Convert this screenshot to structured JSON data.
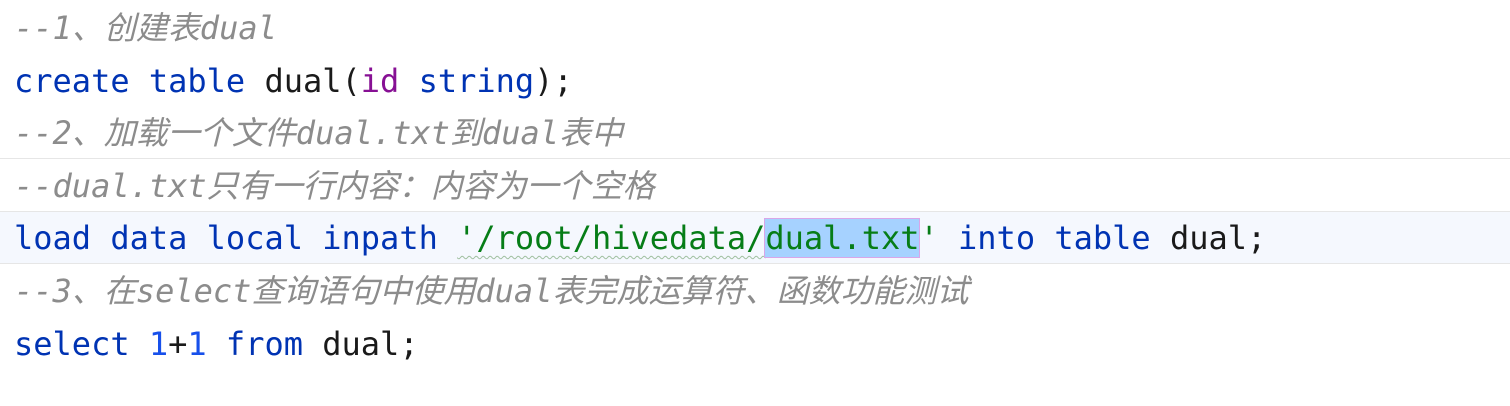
{
  "editor": {
    "lines": [
      {
        "comment": "--1、创建表dual"
      },
      {
        "kw_create": "create",
        "kw_table": "table",
        "ident": "dual",
        "open_paren": "(",
        "field": "id",
        "type": "string",
        "close": ");"
      },
      {
        "comment": "--2、加载一个文件dual.txt到dual表中"
      },
      {
        "comment": "--dual.txt只有一行内容：内容为一个空格"
      },
      {
        "kw_load": "load",
        "kw_data": "data",
        "kw_local": "local",
        "kw_inpath": "inpath",
        "str_prefix": "'/root/hivedata/",
        "str_selected": "dual.txt",
        "str_suffix": "'",
        "kw_into": "into",
        "kw_table": "table",
        "ident": "dual",
        "semi": ";"
      },
      {
        "comment": "--3、在select查询语句中使用dual表完成运算符、函数功能测试"
      },
      {
        "kw_select": "select",
        "num1": "1",
        "op": "+",
        "num2": "1",
        "kw_from": "from",
        "ident": "dual",
        "semi": ";"
      }
    ]
  },
  "colors": {
    "keyword": "#0033b3",
    "comment": "#8c8c8c",
    "string": "#067d17",
    "number": "#1750eb",
    "field": "#871094",
    "selection": "#a6d2ff"
  }
}
